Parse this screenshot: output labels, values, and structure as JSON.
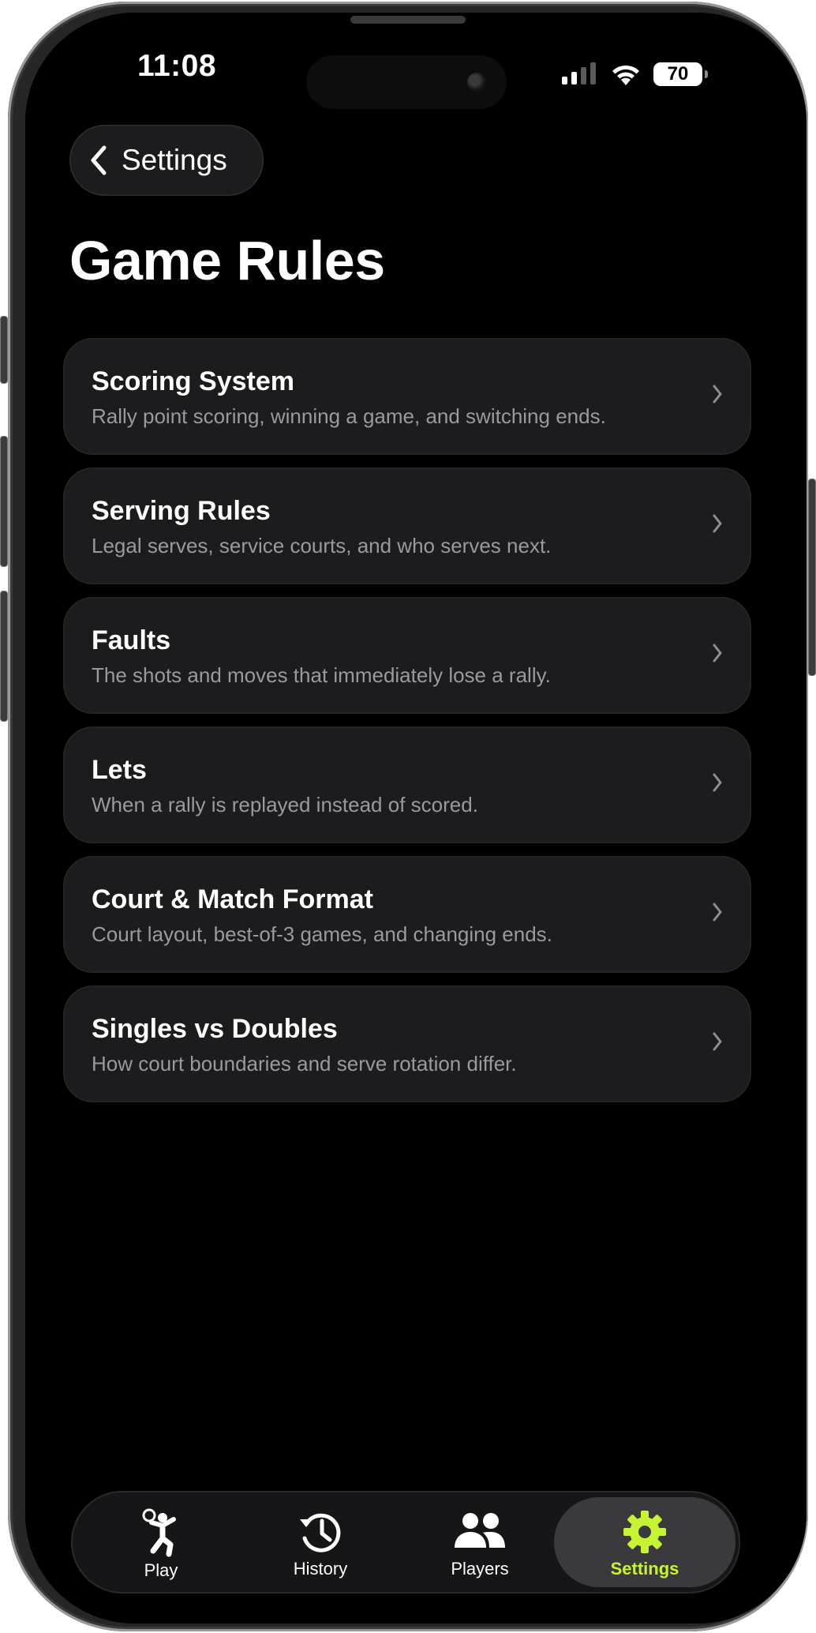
{
  "status_bar": {
    "time": "11:08",
    "battery": "70"
  },
  "nav": {
    "back_label": "Settings"
  },
  "page": {
    "title": "Game Rules"
  },
  "rules": [
    {
      "title": "Scoring System",
      "description": "Rally point scoring, winning a game, and switching ends."
    },
    {
      "title": "Serving Rules",
      "description": "Legal serves, service courts, and who serves next."
    },
    {
      "title": "Faults",
      "description": "The shots and moves that immediately lose a rally."
    },
    {
      "title": "Lets",
      "description": "When a rally is replayed instead of scored."
    },
    {
      "title": "Court & Match Format",
      "description": "Court layout, best-of-3 games, and changing ends."
    },
    {
      "title": "Singles vs Doubles",
      "description": "How court boundaries and serve rotation differ."
    }
  ],
  "tabs": [
    {
      "label": "Play",
      "icon": "player-icon"
    },
    {
      "label": "History",
      "icon": "history-icon"
    },
    {
      "label": "Players",
      "icon": "people-icon"
    },
    {
      "label": "Settings",
      "icon": "gear-icon",
      "active": true
    }
  ],
  "colors": {
    "accent": "#c6f432",
    "card": "#1c1c1e",
    "background": "#000000"
  }
}
